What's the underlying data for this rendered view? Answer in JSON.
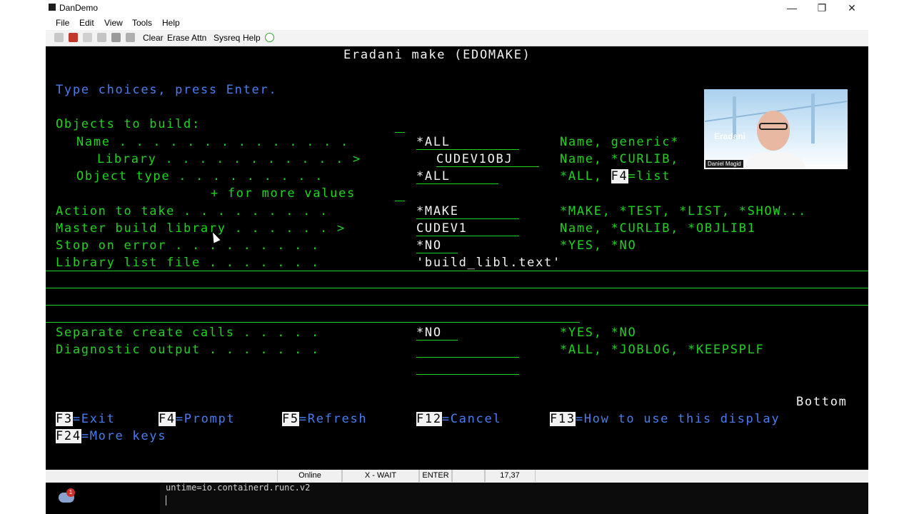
{
  "window": {
    "title": "DanDemo",
    "controls": [
      "minimize",
      "maximize",
      "close"
    ]
  },
  "menu": [
    "File",
    "Edit",
    "View",
    "Tools",
    "Help"
  ],
  "toolbar": {
    "buttons": [
      "Clear",
      "Erase",
      "Attn",
      "Sysreq",
      "Help"
    ]
  },
  "screen": {
    "title": "Eradani make (EDOMAKE)",
    "instruction": "Type choices, press Enter.",
    "section_objects": "Objects to build:",
    "prompts": {
      "name": "Name . . . . . . . . . . . . . .",
      "library": "Library . . . . . . . . . . . >",
      "object_type": "Object type . . . . . . . . .",
      "more_values": "+ for more values",
      "action": "Action to take . . . . . . . . .",
      "master_lib": "Master build library . . . . . . >",
      "stop_on_error": "Stop on error . . . . . . . . .",
      "lib_list_file": "Library list file . . . . . . .",
      "separate_create": "Separate create calls . . . . .",
      "diagnostic": "Diagnostic output . . . . . . ."
    },
    "values": {
      "name": "*ALL",
      "library": "CUDEV1OBJ",
      "object_type": "*ALL",
      "action": "*MAKE",
      "master_lib": "CUDEV1",
      "stop_on_error": "*NO",
      "lib_list_file": "'build_libl.text'",
      "separate_create": "*NO",
      "diagnostic": ""
    },
    "hints": {
      "name": "Name, generic*",
      "library": "Name, *CURLIB,",
      "object_type_pre": "*ALL,",
      "object_type_key": "F4",
      "object_type_post": "=list",
      "action": "*MAKE, *TEST, *LIST, *SHOW...",
      "master_lib": "Name, *CURLIB, *OBJLIB1",
      "stop_on_error": "*YES, *NO",
      "separate_create": "*YES, *NO",
      "diagnostic": "*ALL, *JOBLOG, *KEEPSPLF"
    },
    "bottom": "Bottom",
    "fkeys": [
      {
        "key": "F3",
        "label": "=Exit"
      },
      {
        "key": "F4",
        "label": "=Prompt"
      },
      {
        "key": "F5",
        "label": "=Refresh"
      },
      {
        "key": "F12",
        "label": "=Cancel"
      },
      {
        "key": "F13",
        "label": "=How to use this display"
      },
      {
        "key": "F24",
        "label": "=More keys"
      }
    ]
  },
  "video": {
    "logo": "Eradani",
    "name": "Daniel Magid"
  },
  "status": {
    "online": "Online",
    "wait": "X - WAIT",
    "mode": "ENTER",
    "blank": "",
    "cursor": "17,37"
  },
  "terminal": {
    "line": "untime=io.containerd.runc.v2"
  },
  "taskbar": {
    "badge": "1"
  },
  "colors": {
    "screen_bg": "#000000",
    "green": "#1ed41e",
    "white": "#f2f2f2",
    "blue": "#4a7df0"
  }
}
